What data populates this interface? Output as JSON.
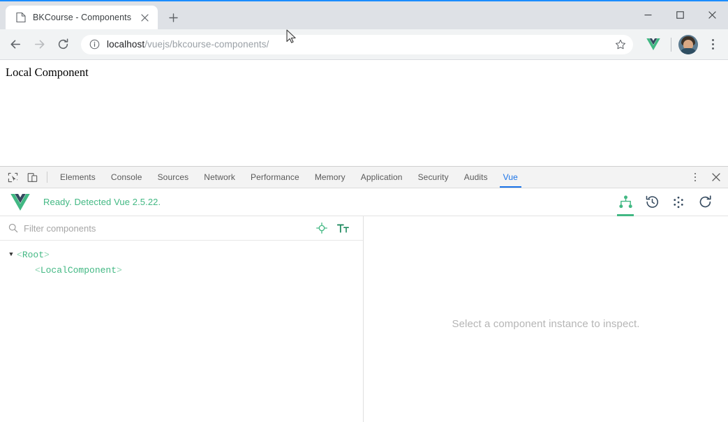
{
  "window": {
    "controls": {
      "minimize": "minimize-button",
      "maximize": "maximize-button",
      "close": "close-button"
    }
  },
  "tabstrip": {
    "tabs": [
      {
        "title": "BKCourse - Components",
        "favicon": "page-icon",
        "active": true
      }
    ],
    "new_tab_label": "+"
  },
  "toolbar": {
    "back": "back-arrow-icon",
    "forward": "forward-arrow-icon",
    "reload": "reload-icon",
    "security_icon": "info-circle-icon",
    "url_host": "localhost",
    "url_path": "/vuejs/bkcourse-components/",
    "bookmark": "star-icon",
    "extension": "vue-extension-icon",
    "profile": "avatar",
    "menu": "kebab-menu-icon"
  },
  "page": {
    "heading": "Local Component"
  },
  "devtools": {
    "inspect_icon": "inspect-element-icon",
    "device_icon": "device-toolbar-icon",
    "tabs": [
      {
        "label": "Elements",
        "active": false
      },
      {
        "label": "Console",
        "active": false
      },
      {
        "label": "Sources",
        "active": false
      },
      {
        "label": "Network",
        "active": false
      },
      {
        "label": "Performance",
        "active": false
      },
      {
        "label": "Memory",
        "active": false
      },
      {
        "label": "Application",
        "active": false
      },
      {
        "label": "Security",
        "active": false
      },
      {
        "label": "Audits",
        "active": false
      },
      {
        "label": "Vue",
        "active": true
      }
    ],
    "more_label": "more-options",
    "close_label": "close-devtools",
    "active_tab_color": "#1a73e8"
  },
  "vue_panel": {
    "logo": "vue-logo",
    "status_text": "Ready. Detected Vue 2.5.22.",
    "status_color": "#42b883",
    "actions": [
      {
        "name": "component-tree-icon",
        "active": true
      },
      {
        "name": "time-travel-icon",
        "active": false
      },
      {
        "name": "events-icon",
        "active": false
      },
      {
        "name": "refresh-icon",
        "active": false
      }
    ],
    "filter": {
      "placeholder": "Filter components",
      "value": "",
      "search_icon": "search-icon",
      "target_icon": "select-component-icon",
      "format_icon": "text-format-icon"
    },
    "tree": [
      {
        "open_bracket": "<",
        "name": "Root",
        "close_bracket": ">",
        "depth": 0,
        "expandable": true,
        "expanded": true
      },
      {
        "open_bracket": "<",
        "name": "LocalComponent",
        "close_bracket": ">",
        "depth": 1,
        "expandable": false,
        "expanded": false
      }
    ],
    "inspector": {
      "empty_message": "Select a component instance to inspect."
    }
  }
}
